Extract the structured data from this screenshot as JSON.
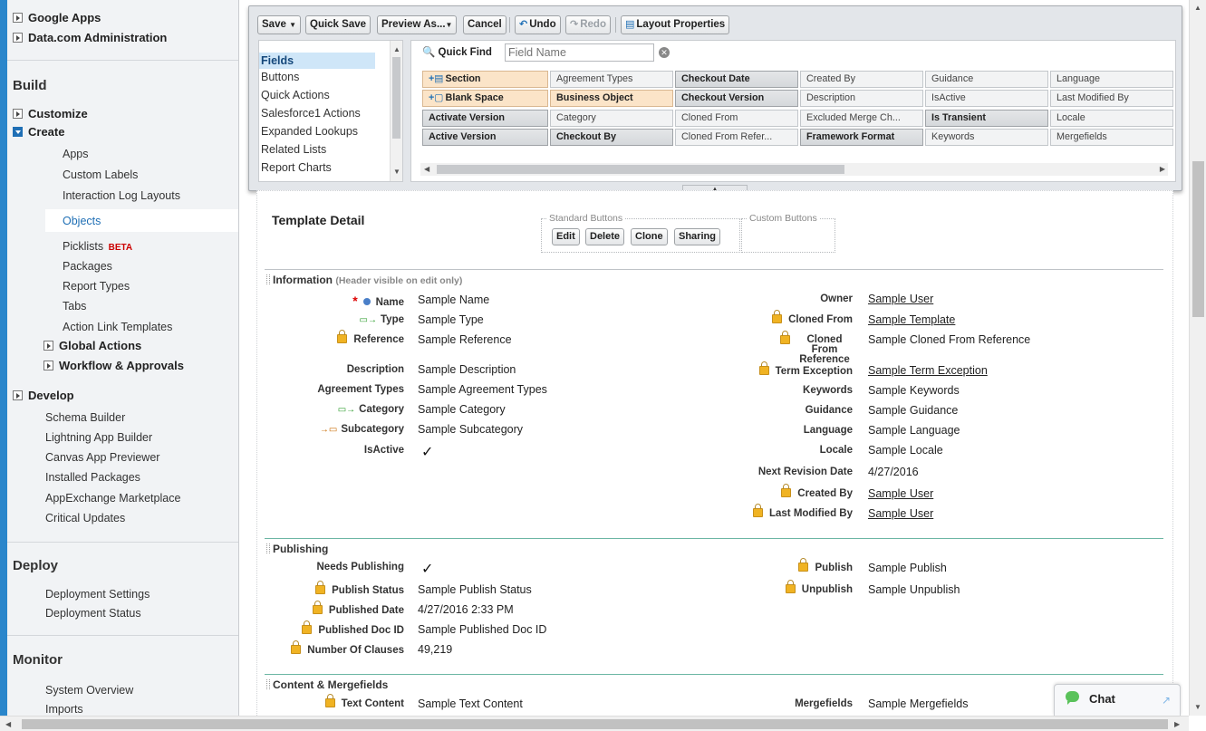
{
  "sidebar": {
    "top_items": [
      "Google Apps",
      "Data.com Administration"
    ],
    "build": {
      "heading": "Build",
      "customize": "Customize",
      "create": "Create",
      "create_items": [
        "Apps",
        "Custom Labels",
        "Interaction Log Layouts",
        "Objects",
        "Picklists",
        "Packages",
        "Report Types",
        "Tabs",
        "Action Link Templates"
      ],
      "beta": "BETA",
      "global_actions": "Global Actions",
      "workflow": "Workflow & Approvals",
      "develop": "Develop",
      "links": [
        "Schema Builder",
        "Lightning App Builder",
        "Canvas App Previewer",
        "Installed Packages",
        "AppExchange Marketplace",
        "Critical Updates"
      ]
    },
    "deploy": {
      "heading": "Deploy",
      "links": [
        "Deployment Settings",
        "Deployment Status"
      ]
    },
    "monitor": {
      "heading": "Monitor",
      "links": [
        "System Overview",
        "Imports"
      ]
    }
  },
  "toolbar": {
    "save": "Save",
    "quick_save": "Quick Save",
    "preview_as": "Preview As...",
    "cancel": "Cancel",
    "undo": "Undo",
    "redo": "Redo",
    "layout_properties": "Layout Properties"
  },
  "palette": {
    "categories": [
      "Fields",
      "Buttons",
      "Quick Actions",
      "Salesforce1 Actions",
      "Expanded Lookups",
      "Related Lists",
      "Report Charts"
    ],
    "quick_find_label": "Quick Find",
    "quick_find_placeholder": "Field Name",
    "fields": [
      [
        "Section",
        "Agreement Types",
        "Checkout Date",
        "Created By",
        "Guidance",
        "Language"
      ],
      [
        "Blank Space",
        "Business Object",
        "Checkout Version",
        "Description",
        "IsActive",
        "Last Modified By"
      ],
      [
        "Activate Version",
        "Category",
        "Cloned From",
        "Excluded Merge Ch...",
        "Is Transient",
        "Locale"
      ],
      [
        "Active Version",
        "Checkout By",
        "Cloned From Refer...",
        "Framework Format",
        "Keywords",
        "Mergefields"
      ]
    ]
  },
  "layout": {
    "title": "Template Detail",
    "standard_buttons_label": "Standard Buttons",
    "custom_buttons_label": "Custom Buttons",
    "standard_buttons": [
      "Edit",
      "Delete",
      "Clone",
      "Sharing"
    ],
    "sections": {
      "information": {
        "title": "Information",
        "hint": "(Header visible on edit only)",
        "left": [
          {
            "label": "Name",
            "value": "Sample Name"
          },
          {
            "label": "Type",
            "value": "Sample Type"
          },
          {
            "label": "Reference",
            "value": "Sample Reference"
          },
          {
            "label": "Description",
            "value": "Sample Description"
          },
          {
            "label": "Agreement Types",
            "value": "Sample Agreement Types"
          },
          {
            "label": "Category",
            "value": "Sample Category"
          },
          {
            "label": "Subcategory",
            "value": "Sample Subcategory"
          },
          {
            "label": "IsActive",
            "value": "✓"
          }
        ],
        "right": [
          {
            "label": "Owner",
            "value": "Sample User"
          },
          {
            "label": "Cloned From",
            "value": "Sample Template"
          },
          {
            "label": "Cloned From Reference",
            "value": "Sample Cloned From Reference"
          },
          {
            "label": "Term Exception",
            "value": "Sample Term Exception"
          },
          {
            "label": "Keywords",
            "value": "Sample Keywords"
          },
          {
            "label": "Guidance",
            "value": "Sample Guidance"
          },
          {
            "label": "Language",
            "value": "Sample Language"
          },
          {
            "label": "Locale",
            "value": "Sample Locale"
          },
          {
            "label": "Next Revision Date",
            "value": "4/27/2016"
          },
          {
            "label": "Created By",
            "value": "Sample User"
          },
          {
            "label": "Last Modified By",
            "value": "Sample User"
          }
        ]
      },
      "publishing": {
        "title": "Publishing",
        "left": [
          {
            "label": "Needs Publishing",
            "value": "✓"
          },
          {
            "label": "Publish Status",
            "value": "Sample Publish Status"
          },
          {
            "label": "Published Date",
            "value": "4/27/2016 2:33 PM"
          },
          {
            "label": "Published Doc ID",
            "value": "Sample Published Doc ID"
          },
          {
            "label": "Number Of Clauses",
            "value": "49,219"
          }
        ],
        "right": [
          {
            "label": "Publish",
            "value": "Sample Publish"
          },
          {
            "label": "Unpublish",
            "value": "Sample Unpublish"
          }
        ]
      },
      "content": {
        "title": "Content & Mergefields",
        "left": [
          {
            "label": "Text Content",
            "value": "Sample Text Content"
          }
        ],
        "right": [
          {
            "label": "Mergefields",
            "value": "Sample Mergefields"
          }
        ]
      }
    }
  },
  "chat": {
    "label": "Chat"
  }
}
